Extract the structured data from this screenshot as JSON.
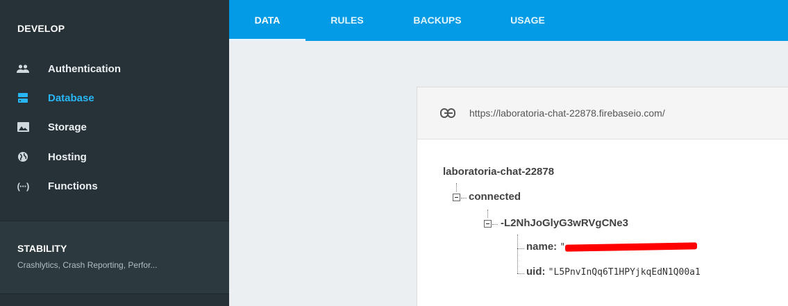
{
  "sidebar": {
    "section_title": "DEVELOP",
    "items": [
      {
        "label": "Authentication",
        "icon": "people-icon"
      },
      {
        "label": "Database",
        "icon": "database-icon",
        "active": true
      },
      {
        "label": "Storage",
        "icon": "image-icon"
      },
      {
        "label": "Hosting",
        "icon": "globe-icon"
      },
      {
        "label": "Functions",
        "icon": "functions-icon"
      }
    ],
    "stability": {
      "title": "STABILITY",
      "subtitle": "Crashlytics, Crash Reporting, Perfor..."
    }
  },
  "tabs": [
    {
      "label": "DATA",
      "active": true
    },
    {
      "label": "RULES"
    },
    {
      "label": "BACKUPS"
    },
    {
      "label": "USAGE"
    }
  ],
  "database": {
    "url": "https://laboratoria-chat-22878.firebaseio.com/",
    "root": "laboratoria-chat-22878",
    "child": "connected",
    "grandchild": "-L2NhJoGlyG3wRVgCNe3",
    "fields": [
      {
        "key": "name:",
        "value": "\"",
        "redacted": true
      },
      {
        "key": "uid:",
        "value": "\"L5PnvInQq6T1HPYjkqEdN1Q00a1"
      }
    ]
  },
  "colors": {
    "sidebar_bg": "#263238",
    "topbar_bg": "#039be5",
    "active_item": "#29b6f6",
    "redaction": "#ff0000"
  }
}
